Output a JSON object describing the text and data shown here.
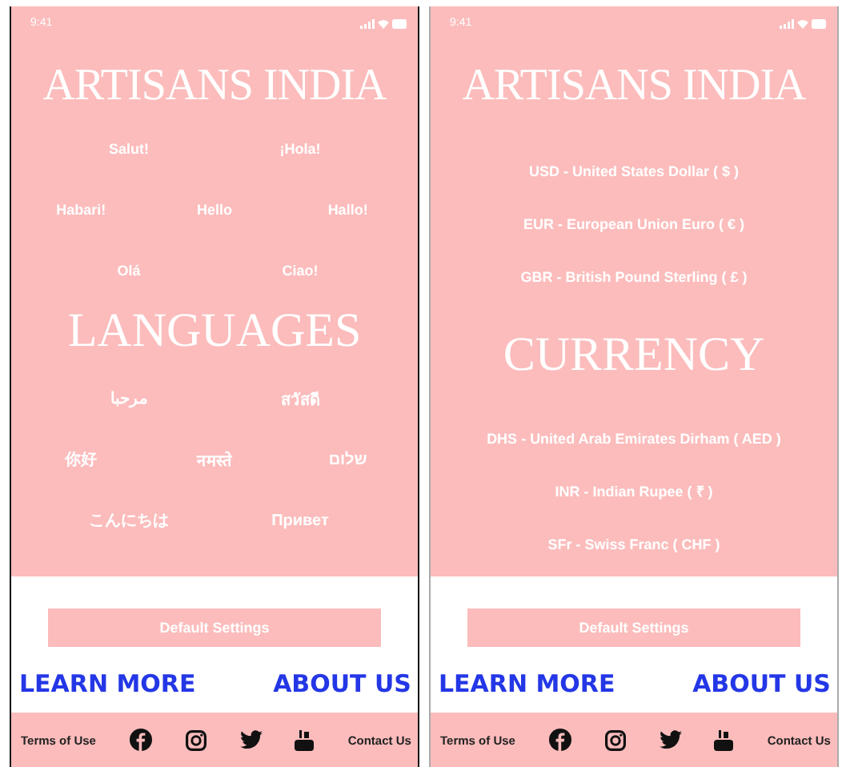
{
  "screens": [
    {
      "kind": "languages",
      "time": "9:41",
      "title": "ARTISANS INDIA",
      "rows_above": [
        [
          "Salut!",
          "¡Hola!"
        ],
        [
          "Habari!",
          "Hello",
          "Hallo!"
        ],
        [
          "Olá",
          "Ciao!"
        ]
      ],
      "heading": "LANGUAGES",
      "rows_below": [
        [
          "مرحبا",
          "สวัสดี"
        ],
        [
          "你好",
          "नमस्ते",
          "שלום"
        ],
        [
          "こんにちは",
          "Привет"
        ]
      ],
      "button": "Default Settings",
      "links": [
        "LEARN MORE",
        "ABOUT US"
      ],
      "footer": {
        "terms": "Terms of Use",
        "contact": "Contact Us"
      }
    },
    {
      "kind": "currency",
      "time": "9:41",
      "title": "ARTISANS INDIA",
      "rows_above": [
        [
          "USD - United States Dollar ( $ )"
        ],
        [
          "EUR - European Union Euro ( € )"
        ],
        [
          "GBR - British Pound Sterling ( £ )"
        ]
      ],
      "heading": "CURRENCY",
      "rows_below": [
        [
          "DHS - United Arab Emirates Dirham ( AED )"
        ],
        [
          "INR - Indian Rupee ( ₹ )"
        ],
        [
          "SFr - Swiss Franc ( CHF )"
        ]
      ],
      "button": "Default Settings",
      "links": [
        "LEARN MORE",
        "ABOUT US"
      ],
      "footer": {
        "terms": "Terms of Use",
        "contact": "Contact Us"
      }
    }
  ]
}
